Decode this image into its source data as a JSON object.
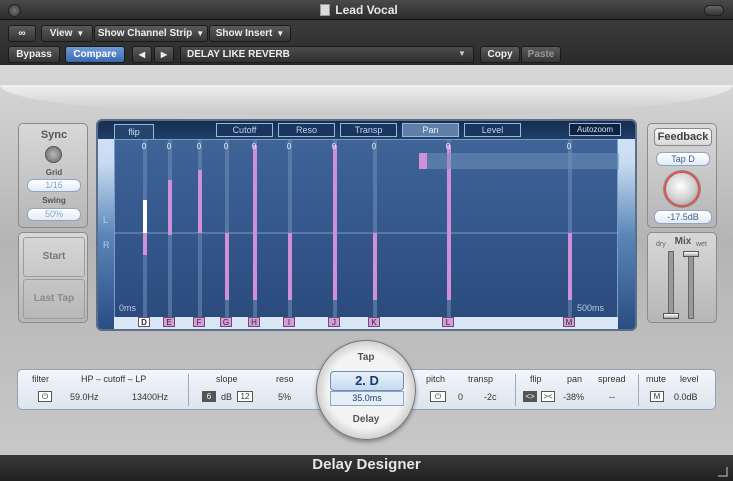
{
  "window": {
    "title": "Lead Vocal"
  },
  "toolbar": {
    "view_label": "View",
    "channel_strip_label": "Show Channel Strip",
    "insert_label": "Show Insert",
    "bypass_label": "Bypass",
    "compare_label": "Compare",
    "prev_label": "◀",
    "next_label": "▶",
    "preset_name": "DELAY LIKE REVERB",
    "copy_label": "Copy",
    "paste_label": "Paste"
  },
  "left_panel": {
    "sync_label": "Sync",
    "grid_label": "Grid",
    "grid_value": "1/16",
    "swing_label": "Swing",
    "swing_value": "50%",
    "start_label": "Start",
    "last_tap_label": "Last Tap"
  },
  "display": {
    "tabs": [
      {
        "label": "Cutoff",
        "selected": false
      },
      {
        "label": "Reso",
        "selected": false
      },
      {
        "label": "Transp",
        "selected": false
      },
      {
        "label": "Pan",
        "selected": true
      },
      {
        "label": "Level",
        "selected": false
      }
    ],
    "flip_label": "flip",
    "autozoom_label": "Autozoom",
    "left_channel_label": "L",
    "right_channel_label": "R",
    "time_start_label": "0ms",
    "time_end_label": "500ms",
    "tap_marker": "0",
    "taps": [
      "D",
      "E",
      "F",
      "G",
      "H",
      "I",
      "J",
      "K",
      "L",
      "M"
    ],
    "selected_tap": "D"
  },
  "right_panel": {
    "feedback_label": "Feedback",
    "feedback_tap": "Tap D",
    "feedback_level": "-17.5dB",
    "mix_label": "Mix",
    "dry_label": "dry",
    "wet_label": "wet",
    "dry_level": 0.05,
    "wet_level": 0.95
  },
  "params": {
    "filter_label": "filter",
    "cutoff_label": "HP – cutoff – LP",
    "hp_value": "59.0Hz",
    "lp_value": "13400Hz",
    "slope_label": "slope",
    "slope_a": "6",
    "slope_unit": "dB",
    "slope_b": "12",
    "reso_label": "reso",
    "reso_value": "5%",
    "pitch_label": "pitch",
    "transp_label": "transp",
    "transp_semis": "0",
    "transp_cents": "-2c",
    "flip_label": "flip",
    "pan_label": "pan",
    "pan_value": "-38%",
    "spread_label": "spread",
    "spread_value": "--",
    "mute_label": "mute",
    "mute_value": "M",
    "level_label": "level",
    "level_value": "0.0dB"
  },
  "center": {
    "tap_label": "Tap",
    "tap_value": "2. D",
    "delay_value": "35.0ms",
    "delay_label": "Delay"
  },
  "footer": {
    "title": "Delay Designer"
  },
  "colors": {
    "tap_bar": "#d08fd9",
    "display_dark": "#2a4d83",
    "accent_blue": "#3a69b0"
  }
}
